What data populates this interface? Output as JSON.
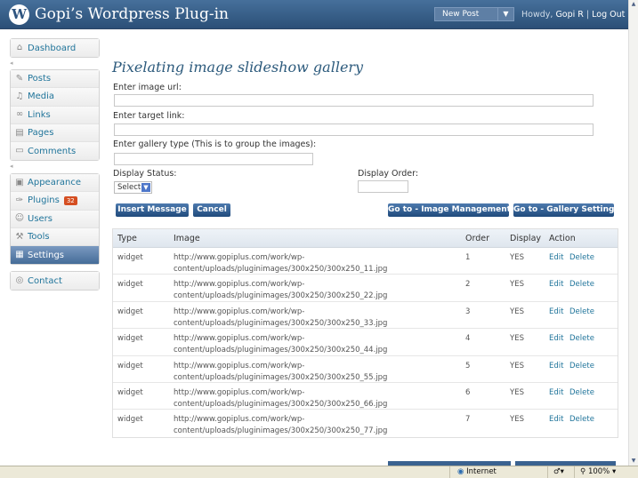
{
  "header": {
    "logo": "W",
    "site_title": "Gopi’s Wordpress Plug-in",
    "new_post": "New Post",
    "howdy_prefix": "Howdy,",
    "user": "Gopi R",
    "separator": "|",
    "logout": "Log Out"
  },
  "sidebar": {
    "dashboard": "Dashboard",
    "posts": "Posts",
    "media": "Media",
    "links": "Links",
    "pages": "Pages",
    "comments": "Comments",
    "appearance": "Appearance",
    "plugins": "Plugins",
    "plugins_badge": "32",
    "users": "Users",
    "tools": "Tools",
    "settings": "Settings",
    "contact": "Contact"
  },
  "form": {
    "title": "Pixelating image slideshow gallery",
    "image_url_label": "Enter image url:",
    "target_link_label": "Enter target link:",
    "gallery_type_label": "Enter gallery type (This is to group the images):",
    "display_status_label": "Display Status:",
    "display_status_value": "Select",
    "display_order_label": "Display Order:",
    "insert_button": "Insert Message",
    "cancel_button": "Cancel",
    "image_mgmt_button": "Go to - Image Management",
    "gallery_setting_button": "Go to - Gallery Setting"
  },
  "table": {
    "headers": {
      "type": "Type",
      "image": "Image",
      "order": "Order",
      "display": "Display",
      "action": "Action"
    },
    "edit": "Edit",
    "delete": "Delete",
    "rows": [
      {
        "type": "widget",
        "image_line1": "http://www.gopiplus.com/work/wp-",
        "image_line2": "content/uploads/pluginimages/300x250/300x250_11.jpg",
        "order": "1",
        "display": "YES"
      },
      {
        "type": "widget",
        "image_line1": "http://www.gopiplus.com/work/wp-",
        "image_line2": "content/uploads/pluginimages/300x250/300x250_22.jpg",
        "order": "2",
        "display": "YES"
      },
      {
        "type": "widget",
        "image_line1": "http://www.gopiplus.com/work/wp-",
        "image_line2": "content/uploads/pluginimages/300x250/300x250_33.jpg",
        "order": "3",
        "display": "YES"
      },
      {
        "type": "widget",
        "image_line1": "http://www.gopiplus.com/work/wp-",
        "image_line2": "content/uploads/pluginimages/300x250/300x250_44.jpg",
        "order": "4",
        "display": "YES"
      },
      {
        "type": "widget",
        "image_line1": "http://www.gopiplus.com/work/wp-",
        "image_line2": "content/uploads/pluginimages/300x250/300x250_55.jpg",
        "order": "5",
        "display": "YES"
      },
      {
        "type": "widget",
        "image_line1": "http://www.gopiplus.com/work/wp-",
        "image_line2": "content/uploads/pluginimages/300x250/300x250_66.jpg",
        "order": "6",
        "display": "YES"
      },
      {
        "type": "widget",
        "image_line1": "http://www.gopiplus.com/work/wp-",
        "image_line2": "content/uploads/pluginimages/300x250/300x250_77.jpg",
        "order": "7",
        "display": "YES"
      }
    ]
  },
  "statusbar": {
    "zone": "Internet",
    "zoom": "100%"
  },
  "colors": {
    "header": "#3a5f88",
    "link": "#21759b",
    "button": "#2f5c8f",
    "badge": "#d54e21"
  }
}
